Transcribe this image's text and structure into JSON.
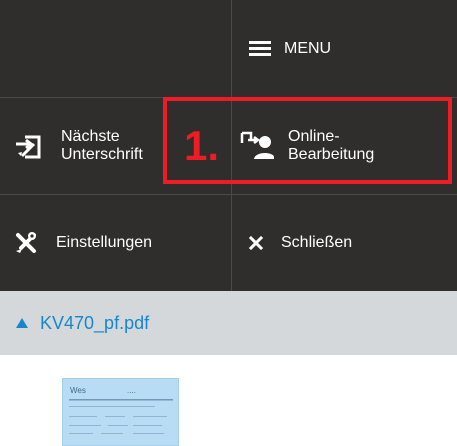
{
  "toolbar": {
    "menu_label": "MENU",
    "next_signature_label": "Nächste\nUnterschrift",
    "online_editing_label": "Online-\nBearbeitung",
    "settings_label": "Einstellungen",
    "close_label": "Schließen"
  },
  "annotation": {
    "label": "1.",
    "color": "#ee1c24"
  },
  "document": {
    "file_name": "KV470_pf.pdf",
    "thumbnail_title": "Wes",
    "thumbnail_subtitle": "...."
  },
  "colors": {
    "toolbar_background": "#302e2d",
    "file_bar_background": "#d4d8da",
    "link_blue": "#1687cc",
    "thumbnail_blue": "#b7dcf4"
  },
  "icons": {
    "menu": "hamburger-icon",
    "next_signature": "sign-next-icon",
    "online_editing": "online-editing-icon",
    "settings": "tools-icon",
    "close": "close-icon",
    "file": "triangle-up-icon"
  }
}
